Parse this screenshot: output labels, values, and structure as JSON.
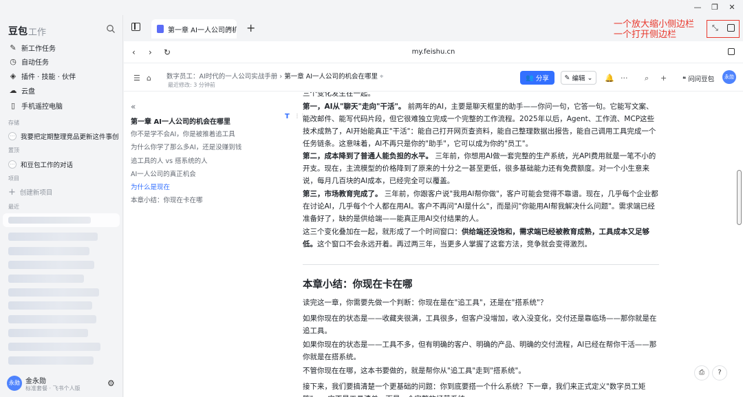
{
  "window": {
    "minimize": "—",
    "restore": "❐",
    "close": "✕"
  },
  "sidebar": {
    "brand": "豆包",
    "brand_sub": "工作",
    "items": [
      {
        "icon": "edit-icon",
        "label": "新工作任务"
      },
      {
        "icon": "clock-icon",
        "label": "自动任务"
      },
      {
        "icon": "layers-icon",
        "label": "插件 · 技能 · 伙伴"
      },
      {
        "icon": "cloud-icon",
        "label": "云盘"
      },
      {
        "icon": "phone-icon",
        "label": "手机遥控电脑"
      }
    ],
    "section_pinned": "存储",
    "pinned_task": "我要把定期整理竞品更新这件事创",
    "section_favorites": "置顶",
    "favorite_conv": "和豆包工作的对话",
    "section_projects": "项目",
    "new_project": "创建新项目",
    "section_recent": "最近",
    "user": {
      "avatar": "永勋",
      "name": "金永勋",
      "plan": "标准套餐 · 飞书个人版"
    }
  },
  "tabs": [
    {
      "label": "第一章 AI一人公司的机",
      "close": "✕"
    }
  ],
  "annotation": {
    "line1": "一个放大缩小侧边栏",
    "line2": "一个打开侧边栏"
  },
  "url": "my.feishu.cn",
  "doc": {
    "breadcrumb_parent": "数字员工：AI时代的一人公司实战手册",
    "breadcrumb_sep": "›",
    "breadcrumb_current": "第一章 AI一人公司的机会在哪里",
    "last_modified": "最近修改: 3 分钟前",
    "share": "分享",
    "edit": "编辑",
    "ask": "问问豆包",
    "avatar": "永勋"
  },
  "outline": {
    "items": [
      "第一章 AI一人公司的机会在哪里",
      "你不是学不会AI，你是被推着追工具",
      "为什么你学了那么多AI，还是没赚到钱",
      "追工具的人 vs 搭系统的人",
      "AI一人公司的真正机会",
      "为什么是现在",
      "本章小结：你现在卡在哪"
    ]
  },
  "content": {
    "cut_top": "三个变化发生在一起。",
    "p1_lead": "第一，AI从\"聊天\"走向\"干活\"。",
    "p1_body": "前两年的AI，主要是聊天框里的助手——你问一句，它答一句。它能写文案、能改邮件、能写代码片段，但它很难独立完成一个完整的工作流程。2025年以后，Agent、工作流、MCP这些技术成熟了，AI开始能真正\"干活\"：能自己打开网页查资料，能自己整理数据出报告，能自己调用工具完成一个任务链条。这意味着，AI不再只是你的\"助手\"，它可以成为你的\"员工\"。",
    "p2_lead": "第二，成本降到了普通人能负担的水平。",
    "p2_body": "三年前，你想用AI做一套完整的生产系统，光API费用就是一笔不小的开支。现在，主流模型的价格降到了原来的十分之一甚至更低，很多基础能力还有免费额度。对一个小生意来说，每月几百块的AI成本，已经完全可以覆盖。",
    "p3_lead": "第三，市场教育完成了。",
    "p3_body": "三年前，你跟客户说\"我用AI帮你做\"，客户可能会觉得不靠谱。现在，几乎每个企业都在讨论AI，几乎每个个人都在用AI。客户不再问\"AI是什么\"，而是问\"你能用AI帮我解决什么问题\"。需求端已经准备好了，缺的是供给端——能真正用AI交付结果的人。",
    "p4_start": "这三个变化叠加在一起，就形成了一个时间窗口：",
    "p4_bold": "供给端还没饱和，需求端已经被教育成熟，工具成本又足够低。",
    "p4_end": "这个窗口不会永远开着。再过两三年，当更多人掌握了这套方法，竞争就会变得激烈。",
    "h2": "本章小结：你现在卡在哪",
    "s1": "读完这一章，你需要先做一个判断：你现在是在\"追工具\"，还是在\"搭系统\"？",
    "s2": "如果你现在的状态是——收藏夹很满，工具很多，但客户没增加，收入没变化，交付还是靠临场——那你就是在追工具。",
    "s3": "如果你现在的状态是——工具不多，但有明确的客户、明确的产品、明确的交付流程，AI已经在帮你干活——那你就是在搭系统。",
    "s4": "不管你现在在哪，这本书要做的，就是帮你从\"追工具\"走到\"搭系统\"。",
    "s5": "接下来，我们要搞清楚一个更基础的问题：你到底要搭一个什么系统？下一章，我们来正式定义\"数字员工矩阵\"——它不是工具清单，而是一个完整的经营系统。"
  }
}
